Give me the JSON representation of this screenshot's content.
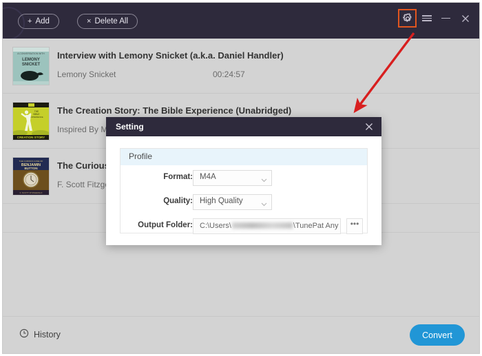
{
  "app": {
    "accent_blue": "#2196d6",
    "header_bg": "#2e2a3c",
    "body_bg": "#d3d3d3",
    "highlight_color": "#e2561f",
    "annotation_color": "#d81f1f"
  },
  "toolbar": {
    "add_label": "Add",
    "add_glyph": "+",
    "delete_label": "Delete All",
    "delete_glyph": "×",
    "icons": [
      {
        "name": "gear-icon",
        "label": "Settings",
        "highlighted": true
      },
      {
        "name": "menu-icon",
        "label": "Menu",
        "highlighted": false
      },
      {
        "name": "minimize-icon",
        "label": "Minimize",
        "highlighted": false
      },
      {
        "name": "close-icon",
        "label": "Close",
        "highlighted": false
      }
    ]
  },
  "list": {
    "items": [
      {
        "title": "Interview with Lemony Snicket (a.k.a. Daniel Handler)",
        "author": "Lemony Snicket",
        "duration": "00:24:57",
        "cover": "lemony-snicket-cover"
      },
      {
        "title": "The Creation Story: The Bible Experience (Unabridged)",
        "author": "Inspired By Me",
        "duration": "",
        "cover": "creation-story-cover"
      },
      {
        "title": "The Curious",
        "author": "F. Scott Fitzgera",
        "duration": "",
        "cover": "benjamin-button-cover"
      }
    ]
  },
  "footer": {
    "history_label": "History",
    "convert_label": "Convert"
  },
  "dialog": {
    "title": "Setting",
    "close_glyph": "×",
    "panel_title": "Profile",
    "fields": {
      "format_label": "Format:",
      "format_value": "M4A",
      "quality_label": "Quality:",
      "quality_value": "High Quality",
      "output_label": "Output Folder:",
      "output_prefix": "C:\\Users\\",
      "output_suffix": "\\TunePat Any Aud",
      "browse_label": "•••"
    }
  }
}
